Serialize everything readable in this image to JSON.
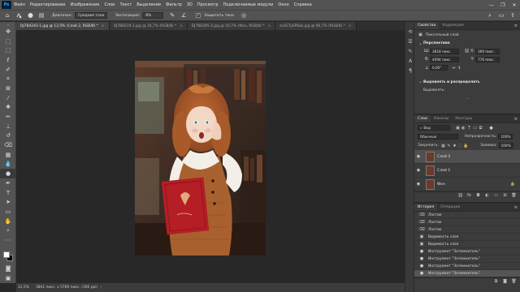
{
  "menubar": {
    "logo": "Ps",
    "items": [
      "Файл",
      "Редактирование",
      "Изображение",
      "Слои",
      "Текст",
      "Выделение",
      "Фильтр",
      "3D",
      "Просмотр",
      "Подключаемые модули",
      "Окно",
      "Справка"
    ],
    "win_minimize": "—",
    "win_restore": "❐",
    "win_close": "✕"
  },
  "options": {
    "sample_label": "Диапазон:",
    "sample_value": "Средние тона",
    "exposure_label": "Экспозиция:",
    "exposure_value": "8%",
    "protect_label": "Защитить тона",
    "protect_checked": "✓"
  },
  "tabs": [
    {
      "label": "DJ7B4243-1.jpg @ 12,5% (Слой 2, RGB/8) *"
    },
    {
      "label": "DJ7B8210-1.jpg @ 16,7% (RGB/8) *"
    },
    {
      "label": "DJ7B8285-3.jpg @ 16,7% (Фон, RGB/8) *"
    },
    {
      "label": "avSCTy6P8ak.jpg @ 66,7% (RGB/8) *"
    }
  ],
  "status": {
    "zoom": "12,5%",
    "size": "3841 пикс. x 5760 пикс. (300 ppi)"
  },
  "properties": {
    "tab_properties": "Свойства",
    "tab_corrections": "Коррекция",
    "layer_type": "Пиксельный слой",
    "transform_title": "Перспектива",
    "w_label": "Ш:",
    "w_value": "3818 пикс.",
    "x_label": "X:",
    "x_value": "369 пикс.",
    "h_label": "В:",
    "h_value": "4094 пикс.",
    "y_label": "Y:",
    "y_value": "776 пикс.",
    "angle": "0,00°",
    "align_title": "Выровнять и распределить",
    "align_label": "Выровнять:"
  },
  "layers_panel": {
    "tab_layers": "Слои",
    "tab_channels": "Каналы",
    "tab_paths": "Контуры",
    "filter_placeholder": "Вид",
    "blend_mode": "Обычные",
    "opacity_label": "Непрозрачность:",
    "opacity_value": "100%",
    "lock_label": "Закрепить:",
    "fill_label": "Заливка:",
    "fill_value": "100%",
    "layers": [
      {
        "name": "Слой 2",
        "selected": true
      },
      {
        "name": "Слой 1",
        "selected": false
      },
      {
        "name": "Фон",
        "selected": false
      }
    ]
  },
  "history_panel": {
    "tab_history": "История",
    "tab_actions": "Операции",
    "items": [
      {
        "label": "Ластик"
      },
      {
        "label": "Ластик"
      },
      {
        "label": "Ластик"
      },
      {
        "label": "Видимость слоя"
      },
      {
        "label": "Видимость слоя"
      },
      {
        "label": "Инструмент \"Затемнитель\""
      },
      {
        "label": "Инструмент \"Затемнитель\""
      },
      {
        "label": "Инструмент \"Затемнитель\""
      },
      {
        "label": "Инструмент \"Затемнитель\""
      }
    ]
  },
  "colors": {
    "accent": "#31a8ff",
    "chrome": "#535353",
    "canvas_bg": "#282828"
  }
}
